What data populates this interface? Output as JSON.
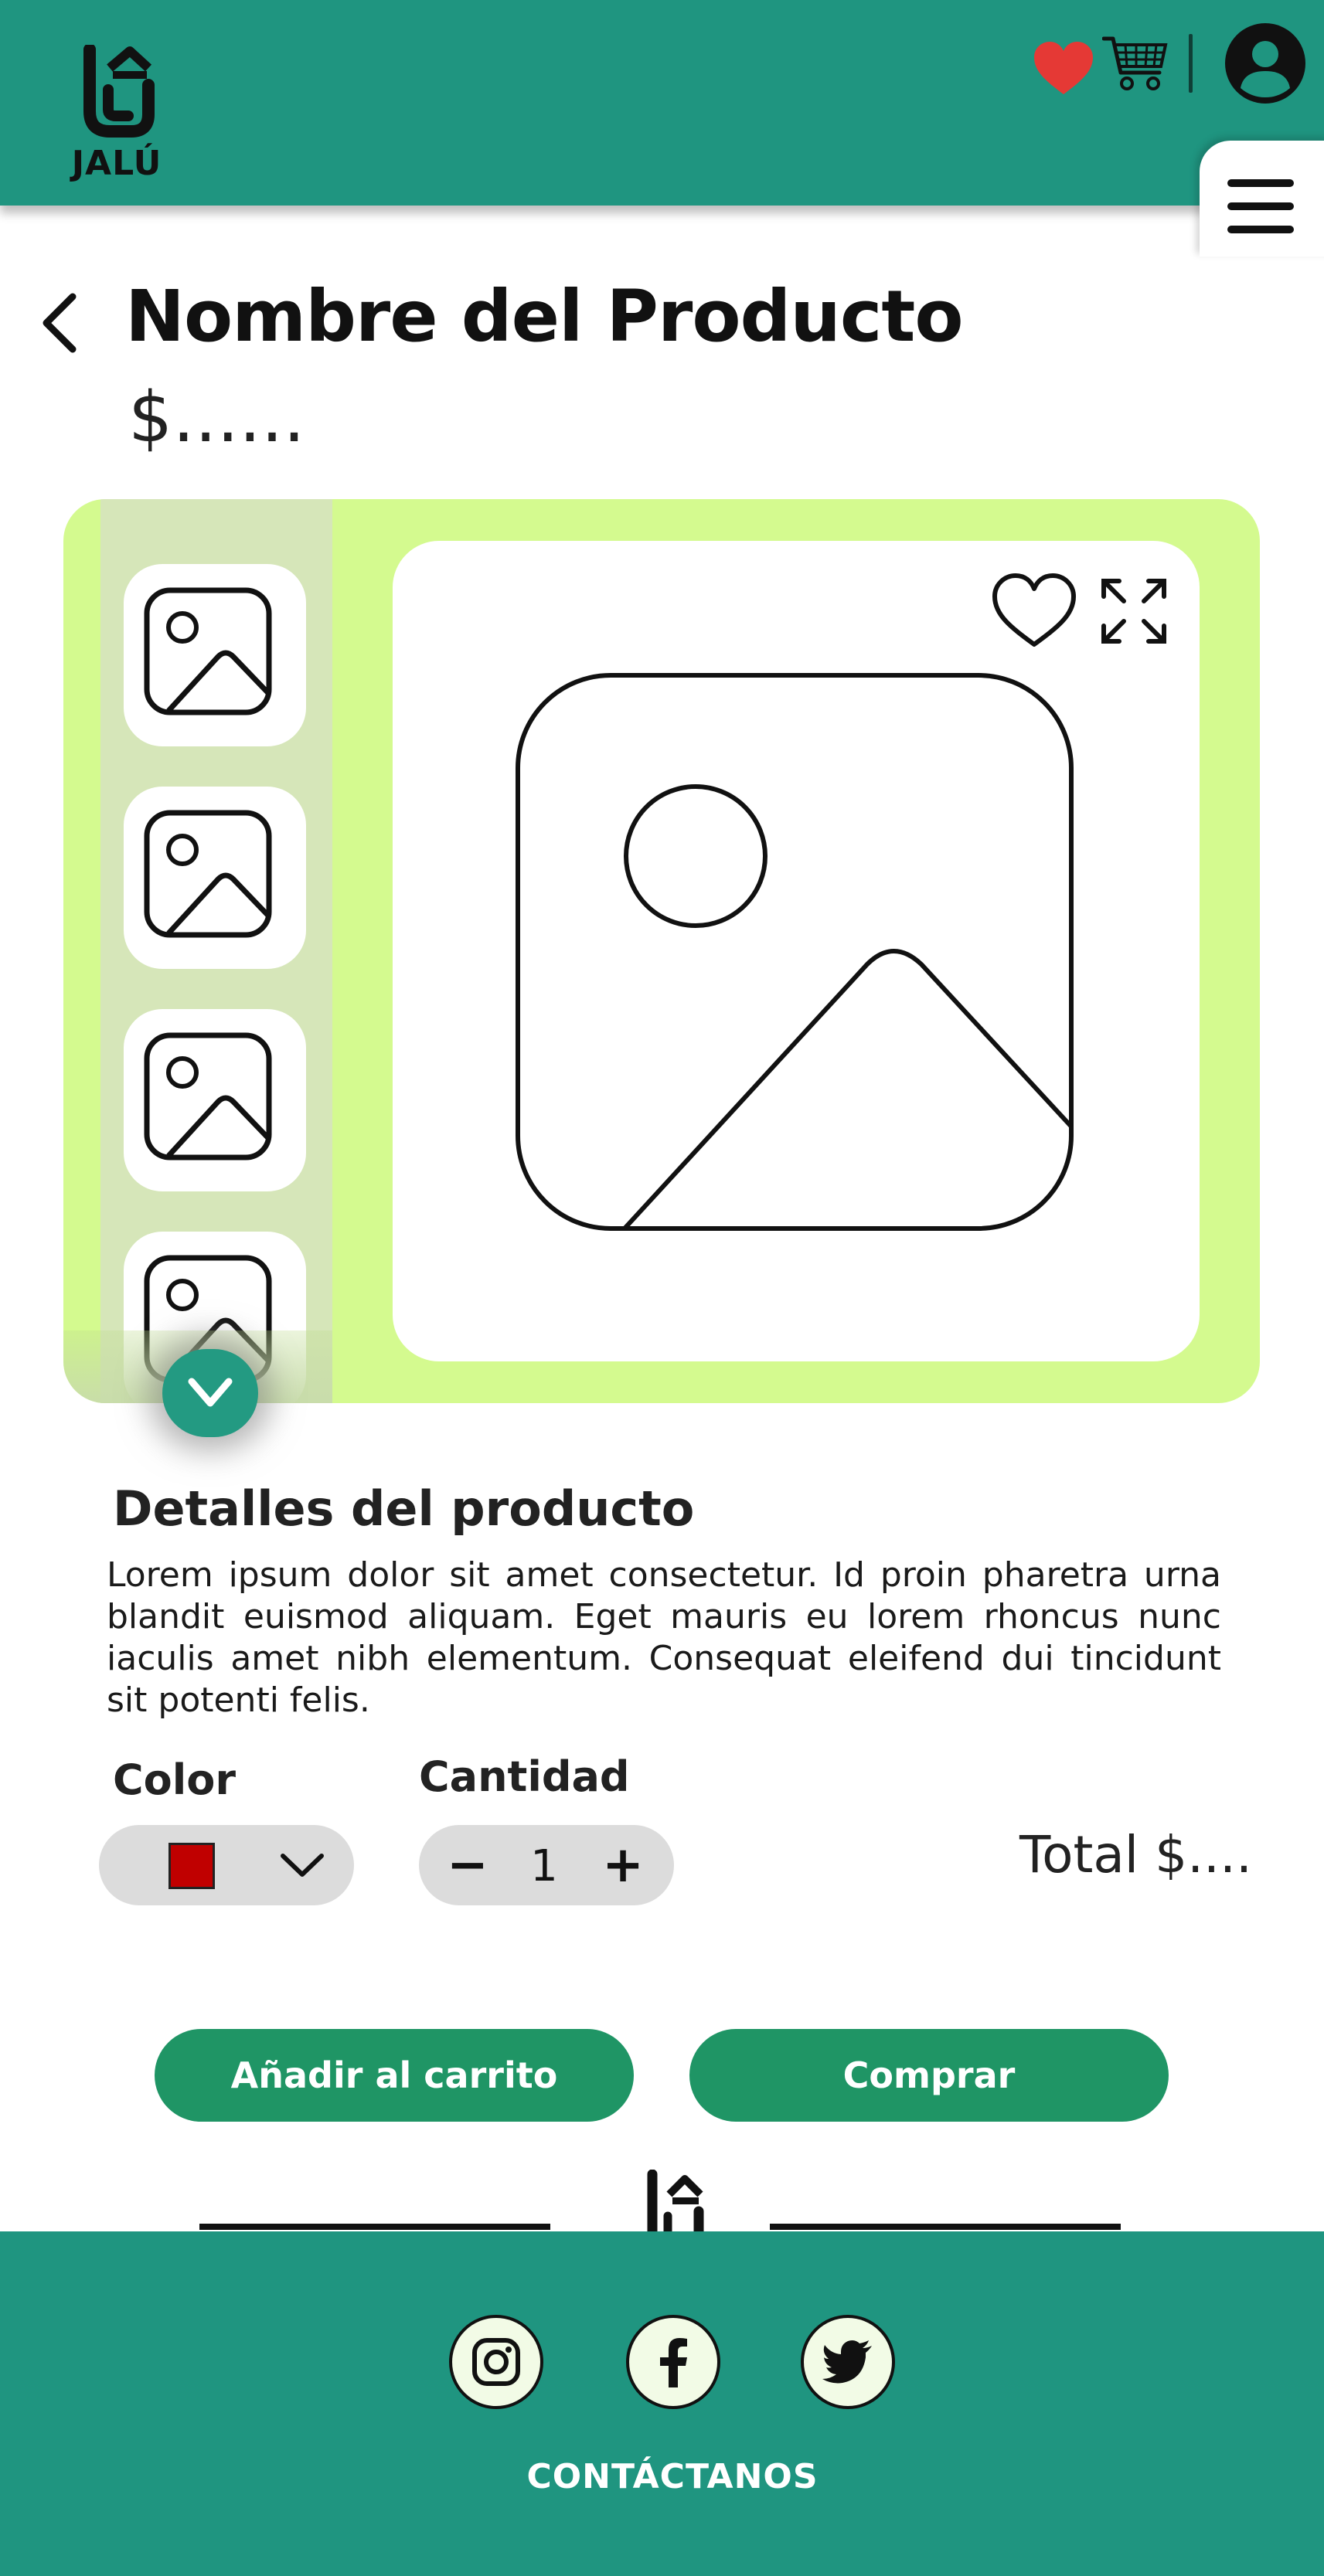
{
  "header": {
    "brand": "JALÚ",
    "colors": {
      "header_bg": "#1f9580",
      "favorite_heart": "#e53935"
    },
    "icons": [
      "favorites-heart-icon",
      "shopping-cart-icon",
      "user-avatar-icon",
      "hamburger-menu-icon"
    ]
  },
  "product": {
    "title": "Nombre del Producto",
    "price": "$......"
  },
  "gallery": {
    "colors": {
      "bg": "#d4fa8f",
      "thumb_column": "#d6e6b9",
      "scroll_button": "#239a82"
    },
    "thumbnail_count": 4
  },
  "details": {
    "heading": "Detalles del producto",
    "description": "Lorem ipsum dolor sit amet consectetur. Id proin pharetra urna blandit euismod aliquam. Eget mauris eu lorem rhoncus nunc iaculis amet nibh elementum. Consequat eleifend dui tincidunt sit potenti felis."
  },
  "options": {
    "color_label": "Color",
    "selected_color": "#c00000",
    "quantity_label": "Cantidad",
    "minus": "−",
    "quantity": "1",
    "plus": "+",
    "total": "Total $...."
  },
  "actions": {
    "add_to_cart": "Añadir al carrito",
    "buy": "Comprar",
    "button_color": "#1f9565"
  },
  "footer": {
    "contact": "CONTÁCTANOS",
    "social": [
      "instagram-icon",
      "facebook-icon",
      "twitter-icon"
    ]
  }
}
